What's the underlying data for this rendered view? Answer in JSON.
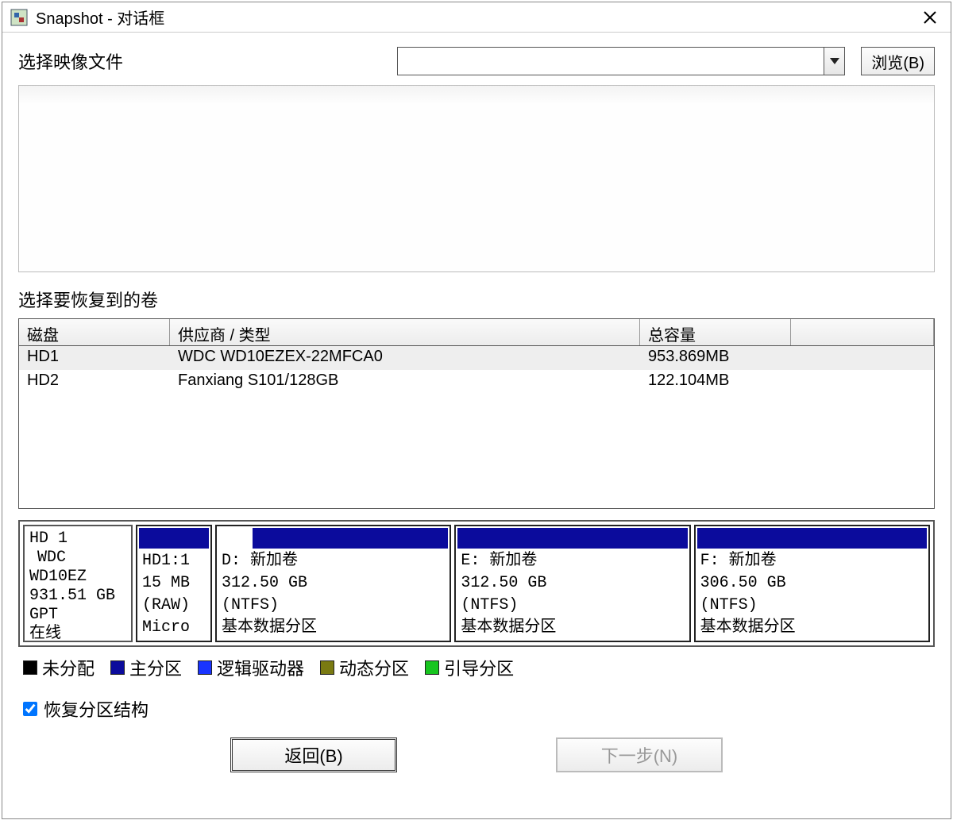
{
  "window": {
    "title": "Snapshot - 对话框"
  },
  "labels": {
    "select_image": "选择映像文件",
    "browse": "浏览(B)",
    "select_volume": "选择要恢复到的卷",
    "restore_structure": "恢复分区结构"
  },
  "disk_table": {
    "headers": {
      "disk": "磁盘",
      "vendor": "供应商 / 类型",
      "capacity": "总容量"
    },
    "rows": [
      {
        "disk": "HD1",
        "vendor": "WDC WD10EZEX-22MFCA0",
        "capacity": "953.869MB"
      },
      {
        "disk": "HD2",
        "vendor": "Fanxiang S101/128GB",
        "capacity": "122.104MB"
      }
    ]
  },
  "partition": {
    "info": {
      "name": "HD 1",
      "model": "WDC WD10EZ",
      "size": "931.51 GB",
      "scheme": "GPT",
      "status": "在线"
    },
    "small": {
      "label": "HD1:1",
      "size": "15 MB",
      "fs": "(RAW)",
      "type": "Micro"
    },
    "parts": [
      {
        "letter": "D: 新加卷",
        "size": "312.50 GB",
        "fs": "(NTFS)",
        "type": "基本数据分区",
        "used_pct": 15
      },
      {
        "letter": "E: 新加卷",
        "size": "312.50 GB",
        "fs": "(NTFS)",
        "type": "基本数据分区",
        "used_pct": 0
      },
      {
        "letter": "F: 新加卷",
        "size": "306.50 GB",
        "fs": "(NTFS)",
        "type": "基本数据分区",
        "used_pct": 0
      }
    ]
  },
  "legend": {
    "unallocated": "未分配",
    "primary": "主分区",
    "logical": "逻辑驱动器",
    "dynamic": "动态分区",
    "boot": "引导分区"
  },
  "buttons": {
    "back": "返回(B)",
    "next": "下一步(N)"
  }
}
